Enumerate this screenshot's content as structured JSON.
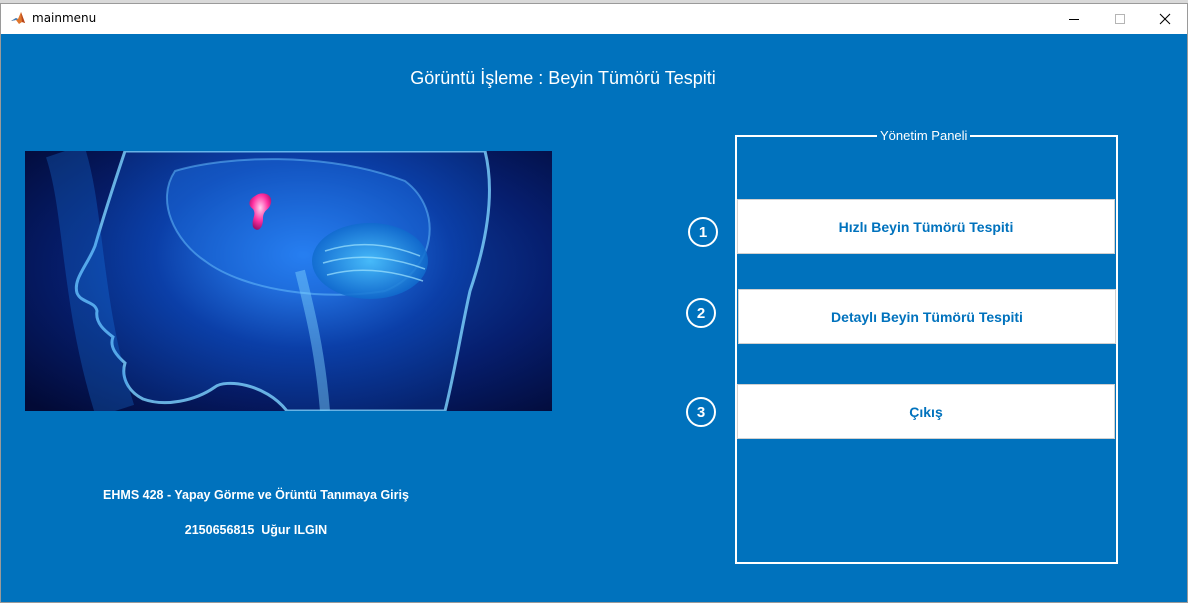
{
  "window": {
    "title": "mainmenu",
    "minimize_symbol": "—",
    "close_symbol": "✕"
  },
  "main": {
    "title": "Görüntü İşleme : Beyin Tümörü Tespiti",
    "course": "EHMS 428 - Yapay Görme ve Örüntü Tanımaya Giriş",
    "student": "2150656815  Uğur ILGIN"
  },
  "panel": {
    "title": "Yönetim Paneli",
    "steps": [
      {
        "number": "1",
        "label": "Hızlı Beyin Tümörü Tespiti"
      },
      {
        "number": "2",
        "label": "Detaylı Beyin Tümörü Tespiti"
      },
      {
        "number": "3",
        "label": "Çıkış"
      }
    ]
  },
  "colors": {
    "background": "#0072bd",
    "button_text": "#0072bd",
    "button_bg": "#ffffff"
  }
}
